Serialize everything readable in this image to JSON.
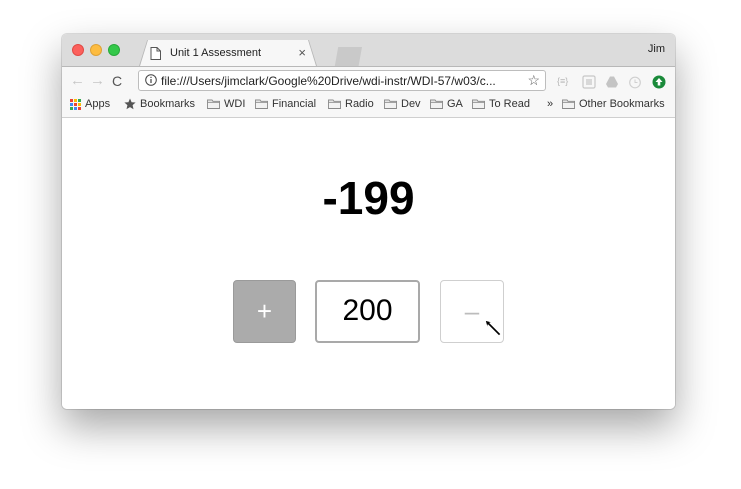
{
  "browser": {
    "tab_title": "Unit 1 Assessment",
    "tab_close": "×",
    "profile_name": "Jim",
    "url": "file:///Users/jimclark/Google%20Drive/wdi-instr/WDI-57/w03/c...",
    "nav_back": "←",
    "nav_forward": "→",
    "nav_reload": "C",
    "star": "☆",
    "ext1_label": "{≡}"
  },
  "bookmarks_bar": {
    "items": [
      {
        "label": "Apps",
        "icon": "apps-grid-icon"
      },
      {
        "label": "Bookmarks",
        "icon": "star-icon"
      },
      {
        "label": "WDI",
        "icon": "folder-icon"
      },
      {
        "label": "Financial",
        "icon": "folder-icon"
      },
      {
        "label": "Radio",
        "icon": "folder-icon"
      },
      {
        "label": "Dev",
        "icon": "folder-icon"
      },
      {
        "label": "GA",
        "icon": "folder-icon"
      },
      {
        "label": "To Read",
        "icon": "folder-icon"
      }
    ],
    "overflow": "»",
    "other": "Other Bookmarks"
  },
  "page": {
    "count": "-199",
    "plus_label": "+",
    "step_value": "200",
    "minus_label": "–"
  },
  "colors": {
    "plus_button_bg": "#ababab",
    "minus_button_bg": "#ffffff",
    "count_color": "#000000"
  }
}
